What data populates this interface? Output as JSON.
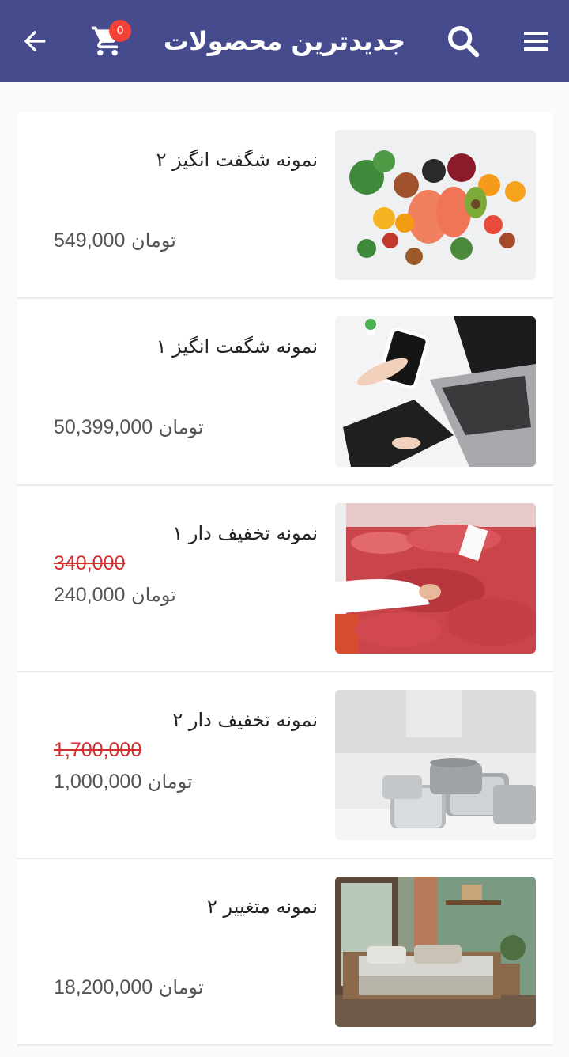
{
  "header": {
    "title": "جدیدترین محصولات",
    "cart_count": "0",
    "icons": [
      "back-arrow-icon",
      "cart-icon",
      "search-icon",
      "menu-icon"
    ],
    "bg_color": "#454b8c",
    "badge_color": "#f44336"
  },
  "products": [
    {
      "name": "نمونه شگفت انگیز ۲",
      "old_price": "",
      "price": "549,000",
      "currency": "تومان",
      "image": "healthy-food-image"
    },
    {
      "name": "نمونه شگفت انگیز ۱",
      "old_price": "",
      "price": "50,399,000",
      "currency": "تومان",
      "image": "laptop-phone-image"
    },
    {
      "name": "نمونه تخفیف دار ۱",
      "old_price": "340,000",
      "price": "240,000",
      "currency": "تومان",
      "image": "meat-counter-image"
    },
    {
      "name": "نمونه تخفیف دار  ۲",
      "old_price": "1,700,000",
      "price": "1,000,000",
      "currency": "تومان",
      "image": "cookware-pots-image"
    },
    {
      "name": "نمونه متغییر ۲",
      "old_price": "",
      "price": "18,200,000",
      "currency": "تومان",
      "image": "bedroom-image"
    }
  ],
  "old_price_color": "#d32f2f"
}
